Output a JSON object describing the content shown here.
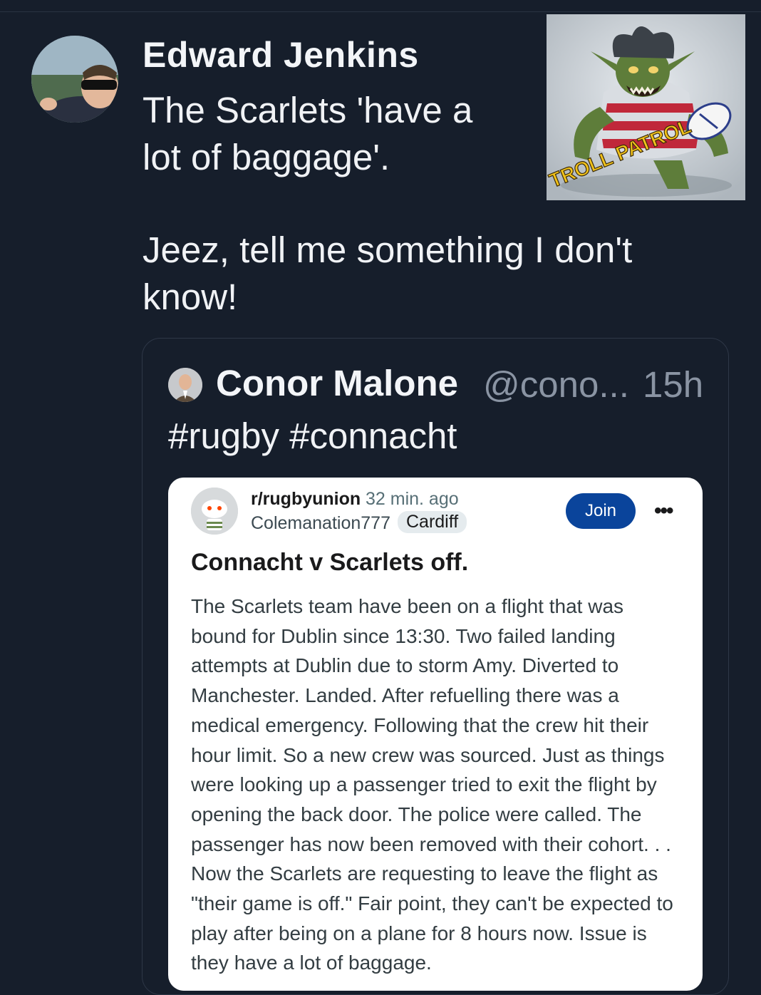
{
  "post": {
    "author": "Edward Jenkins",
    "text_line1": "The Scarlets 'have a\nlot of baggage'.",
    "text_line2": "Jeez, tell me something I don't\nknow!",
    "image_text": "TROLL PATROL"
  },
  "quote": {
    "name": "Conor Malone",
    "handle": "@cono...",
    "time": "15h",
    "tags": [
      "#rugby",
      "#connacht"
    ]
  },
  "reddit": {
    "subreddit": "r/rugbyunion",
    "time": "32 min. ago",
    "user": "Colemanation777",
    "flair": "Cardiff",
    "join_label": "Join",
    "more_label": "•••",
    "title": "Connacht v Scarlets off.",
    "body": "The Scarlets team have been on a flight that was bound for Dublin since 13:30. Two failed landing attempts at Dublin due to storm Amy. Diverted to Manchester. Landed. After refuelling there was a medical emergency. Following that the crew hit their hour limit. So a new crew was sourced. Just as things were looking up a passenger tried to exit the flight by opening the back door. The police were called. The passenger has now been removed with their cohort. . . Now the Scarlets are requesting to leave the flight as \"their game is off.\" Fair point, they can't be expected to play after being on a plane for 8 hours now. Issue is they have a lot of baggage."
  },
  "colors": {
    "background": "#161e2b",
    "join_button": "#0a449b",
    "muted_text": "#8a94a3"
  }
}
